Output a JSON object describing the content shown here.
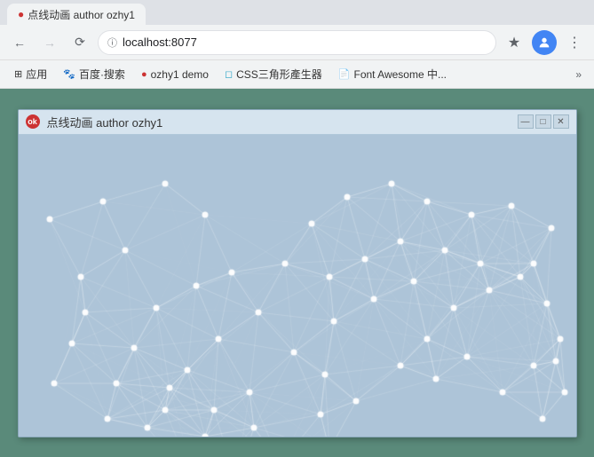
{
  "browser": {
    "url": "localhost:8077",
    "tab_title": "点线动画",
    "back_disabled": false,
    "forward_disabled": false
  },
  "bookmarks": [
    {
      "label": "应用",
      "icon": "⊞"
    },
    {
      "label": "百度·搜索",
      "icon": "🐾"
    },
    {
      "label": "ozhy1 demo",
      "icon": "●"
    },
    {
      "label": "CSS三角形產生器",
      "icon": "◻"
    },
    {
      "label": "Font Awesome 中...",
      "icon": "📄"
    }
  ],
  "app_window": {
    "title": "点线动画 author ozhy1",
    "minimize_label": "—",
    "maximize_label": "□",
    "close_label": "✕"
  },
  "bookmarks_more": "»"
}
